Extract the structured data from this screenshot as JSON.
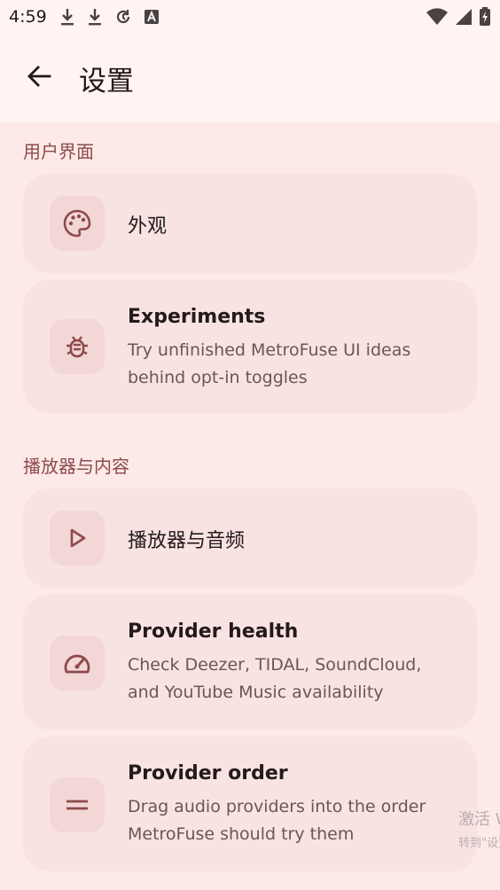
{
  "status_bar": {
    "time": "4:59",
    "left_icons": [
      "download-icon",
      "download-icon",
      "sync-icon",
      "font-a-icon"
    ],
    "right_icons": [
      "wifi-icon",
      "signal-icon",
      "battery-icon"
    ]
  },
  "app_bar": {
    "back_icon": "arrow-back-icon",
    "title": "设置"
  },
  "sections": [
    {
      "header": "用户界面",
      "items": [
        {
          "icon": "palette-icon",
          "title": "外观",
          "subtitle": ""
        },
        {
          "icon": "bug-icon",
          "title": "Experiments",
          "subtitle": "Try unfinished MetroFuse UI ideas behind opt-in toggles"
        }
      ]
    },
    {
      "header": "播放器与内容",
      "items": [
        {
          "icon": "play-icon",
          "title": "播放器与音频",
          "subtitle": ""
        },
        {
          "icon": "speedometer-icon",
          "title": "Provider health",
          "subtitle": "Check Deezer, TIDAL, SoundCloud, and YouTube Music availability"
        },
        {
          "icon": "drag-handle-icon",
          "title": "Provider order",
          "subtitle": "Drag audio providers into the order MetroFuse should try them"
        }
      ]
    }
  ],
  "watermark": {
    "line1": "激活 W",
    "line2": "转到\"设置\""
  },
  "colors": {
    "background": "#fde9e8",
    "app_bar": "#fff4f3",
    "card": "#f8e3e2",
    "icon_tile": "#f3d6d6",
    "accent": "#8d4a4a"
  }
}
